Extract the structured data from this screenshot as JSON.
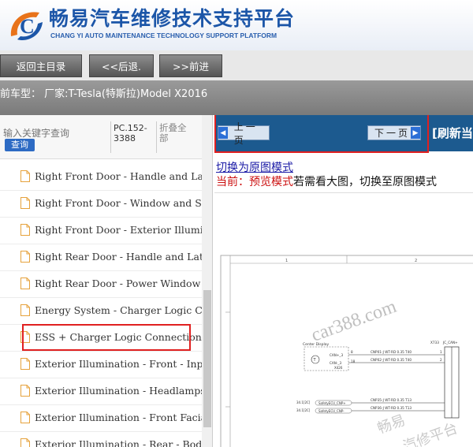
{
  "header": {
    "title_cn": "畅易汽车维修技术支持平台",
    "title_en": "CHANG YI AUTO MAINTENANCE TECHNOLOGY SUPPORT PLATFORM"
  },
  "nav": {
    "back_menu": "返回主目录",
    "back": "<<后退.",
    "forward": ">>前进"
  },
  "model_line": "前车型： 厂家:T-Tesla(特斯拉)Model X2016",
  "search": {
    "placeholder": "输入关键字查询",
    "button": "查询",
    "pc_code": "PC.152-3388",
    "collapse_all": "折叠全部"
  },
  "tree_items": [
    "Right Front Door - Handle and Latch",
    "Right Front Door - Window and Switch",
    "Right Front Door - Exterior Illumination",
    "Right Rear Door - Handle and Latch",
    "Right Rear Door - Power Window",
    "Energy System - Charger Logic Connections",
    "ESS + Charger Logic Connections",
    "Exterior Illumination - Front - Inputs",
    "Exterior Illumination - Headlamps",
    "Exterior Illumination - Front Facia, Side",
    "Exterior Illumination - Rear - Body Side"
  ],
  "viewer": {
    "prev_page": "上一页",
    "next_page": "下一页",
    "refresh": "[刷新当",
    "switch_original": "切换为原图模式",
    "mode_current": "当前：预览模式",
    "mode_hint": "若需看大图，切换至原图模式"
  },
  "schematic": {
    "col1": "1",
    "col2": "2",
    "center_display": "Center Display",
    "can_plus": "CAN+_3",
    "can_minus": "CAN-_3",
    "conn": "X426",
    "pin8": "8",
    "pin18": "18",
    "wire1": "CNP01-J WT-RD 0.35 T40",
    "wire2": "CNP02-J WT-RD 0.35 T40",
    "junction": "X733",
    "junction_label": "JC_CAN+",
    "pin1": "1",
    "pin2": "2",
    "ref1": "34.1[2C]",
    "ref2": "34.1[2C]",
    "safety1": "SafetyECU_CNP+",
    "safety2": "SafetyECU_CNP-",
    "wire3": "CNP35-J WT-RD 0.35 T13",
    "wire4": "CNP36-J WT-RD 0.35 T13",
    "watermark1": "car388.com",
    "watermark2": "畅易",
    "watermark3": "汽修平台"
  },
  "colors": {
    "brand_blue": "#1c56a8",
    "viewer_nav": "#1c5a8f",
    "highlight": "#e02020"
  }
}
